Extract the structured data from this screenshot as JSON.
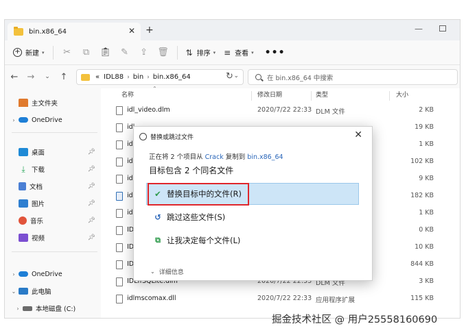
{
  "tab": {
    "title": "bin.x86_64",
    "close_icon": "close-icon",
    "add_icon": "plus-icon"
  },
  "toolbar": {
    "new_label": "新建",
    "sort_label": "排序",
    "view_label": "查看",
    "more_label": "•••"
  },
  "address": {
    "prefix": "«",
    "segments": [
      "IDL88",
      "bin",
      "bin.x86_64"
    ],
    "search_placeholder": "在 bin.x86_64 中搜索"
  },
  "sidebar": {
    "home": "主文件夹",
    "onedrive": "OneDrive",
    "pinned": [
      {
        "label": "桌面",
        "color": "#1f8ad6"
      },
      {
        "label": "下载",
        "color": "#2aa85b"
      },
      {
        "label": "文档",
        "color": "#4a7fd4"
      },
      {
        "label": "图片",
        "color": "#2f7fd0"
      },
      {
        "label": "音乐",
        "color": "#e1543b"
      },
      {
        "label": "视频",
        "color": "#7b4fd1"
      }
    ],
    "onedrive2": "OneDrive",
    "thispc": "此电脑",
    "localdisk": "本地磁盘 (C:)"
  },
  "columns": {
    "name": "名称",
    "date": "修改日期",
    "type": "类型",
    "size": "大小"
  },
  "files": [
    {
      "name": "idl_video.dlm",
      "date": "2020/7/22 22:33",
      "type": "DLM 文件",
      "size": "2 KB",
      "icon": "file-icon"
    },
    {
      "name": "idl_",
      "date": "",
      "type": "",
      "size": "19 KB",
      "icon": "file-icon"
    },
    {
      "name": "idl_",
      "date": "",
      "type": "",
      "size": "1 KB",
      "icon": "file-icon"
    },
    {
      "name": "idl_",
      "date": "",
      "type": "",
      "size": "102 KB",
      "icon": "file-icon"
    },
    {
      "name": "idl_",
      "date": "",
      "type": "",
      "size": "9 KB",
      "icon": "file-icon"
    },
    {
      "name": "idlc",
      "date": "",
      "type": "",
      "size": "182 KB",
      "icon": "exe-icon"
    },
    {
      "name": "idlc",
      "date": "",
      "type": "",
      "size": "1 KB",
      "icon": "file-icon"
    },
    {
      "name": "IDL",
      "date": "",
      "type": "",
      "size": "0 KB",
      "icon": "file-icon"
    },
    {
      "name": "IDL",
      "date": "",
      "type": "",
      "size": "10 KB",
      "icon": "file-icon"
    },
    {
      "name": "IDL",
      "date": "",
      "type": "",
      "size": "844 KB",
      "icon": "file-icon"
    },
    {
      "name": "IDLffSQLite.dlm",
      "date": "2020/7/22 22:33",
      "type": "DLM 文件",
      "size": "3 KB",
      "icon": "file-icon"
    },
    {
      "name": "idlmscomax.dll",
      "date": "2020/7/22 22:33",
      "type": "应用程序扩展",
      "size": "115 KB",
      "icon": "file-icon"
    }
  ],
  "dialog": {
    "title": "替换或跳过文件",
    "line1_pre": "正在将 2 个项目从",
    "line1_src": "Crack",
    "line1_mid": "复制到",
    "line1_dst": "bin.x86_64",
    "line2": "目标包含 2 个同名文件",
    "opt_replace": "替换目标中的文件(R)",
    "opt_skip": "跳过这些文件(S)",
    "opt_decide": "让我决定每个文件(L)",
    "details": "详细信息",
    "close": "✕"
  },
  "watermark": {
    "bottom": "掘金技术社区 @ 用户25558160690",
    "overlay": "160690"
  }
}
